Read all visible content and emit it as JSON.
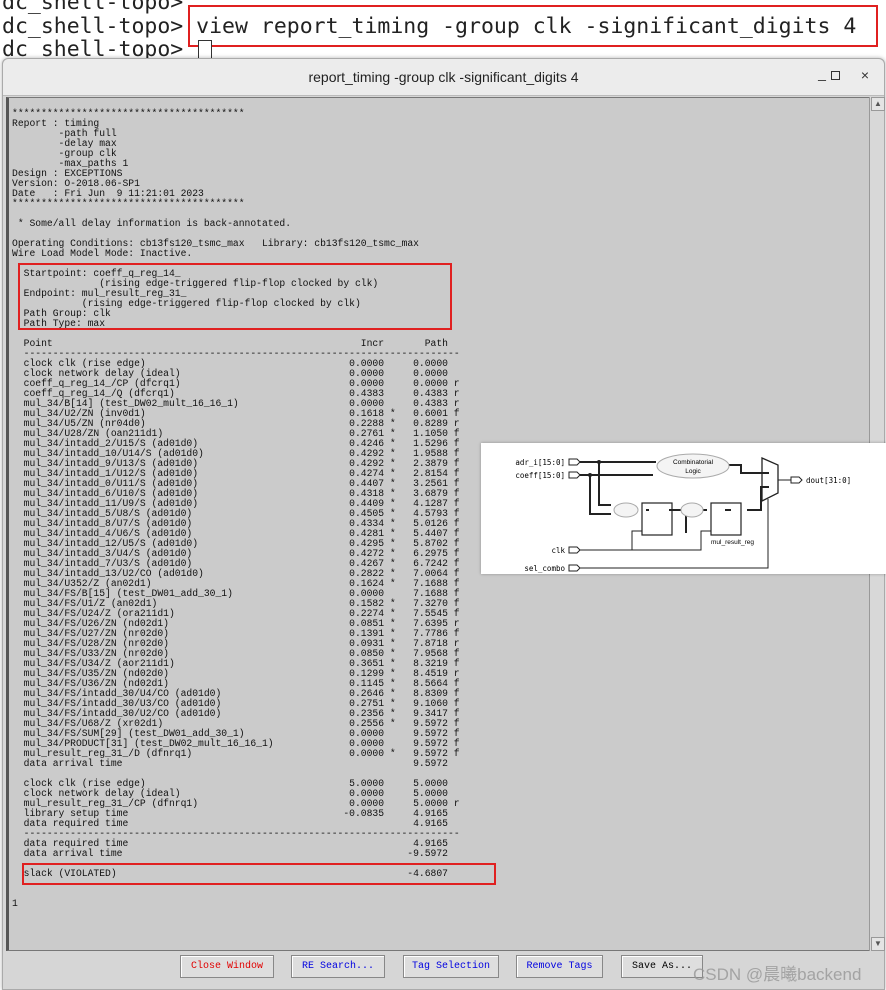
{
  "terminal": {
    "prompt": "dc_shell-topo>",
    "command": "view report_timing -group clk -significant_digits 4"
  },
  "window": {
    "title": "report_timing -group clk -significant_digits 4",
    "minimize": "_",
    "maximize": "□",
    "close": "×"
  },
  "report": {
    "header_lines": [
      "****************************************",
      "Report : timing",
      "        -path full",
      "        -delay max",
      "        -group clk",
      "        -max_paths 1",
      "Design : EXCEPTIONS",
      "Version: O-2018.06-SP1",
      "Date   : Fri Jun  9 11:21:01 2023",
      "****************************************",
      "",
      " * Some/all delay information is back-annotated.",
      "",
      "Operating Conditions: cb13fs120_tsmc_max   Library: cb13fs120_tsmc_max",
      "Wire Load Model Mode: Inactive.",
      "",
      "  Startpoint: coeff_q_reg_14_",
      "               (rising edge-triggered flip-flop clocked by clk)",
      "  Endpoint: mul_result_reg_31_",
      "            (rising edge-triggered flip-flop clocked by clk)",
      "  Path Group: clk",
      "  Path Type: max",
      ""
    ],
    "columns": {
      "point": "Point",
      "incr": "Incr",
      "path": "Path"
    },
    "arrival_rows": [
      {
        "point": "clock clk (rise edge)",
        "incr": "0.0000",
        "star": "",
        "path": "0.0000",
        "edge": ""
      },
      {
        "point": "clock network delay (ideal)",
        "incr": "0.0000",
        "star": "",
        "path": "0.0000",
        "edge": ""
      },
      {
        "point": "coeff_q_reg_14_/CP (dfcrq1)",
        "incr": "0.0000",
        "star": "",
        "path": "0.0000",
        "edge": "r"
      },
      {
        "point": "coeff_q_reg_14_/Q (dfcrq1)",
        "incr": "0.4383",
        "star": "",
        "path": "0.4383",
        "edge": "r"
      },
      {
        "point": "mul_34/B[14] (test_DW02_mult_16_16_1)",
        "incr": "0.0000",
        "star": "",
        "path": "0.4383",
        "edge": "r"
      },
      {
        "point": "mul_34/U2/ZN (inv0d1)",
        "incr": "0.1618",
        "star": "*",
        "path": "0.6001",
        "edge": "f"
      },
      {
        "point": "mul_34/U5/ZN (nr04d0)",
        "incr": "0.2288",
        "star": "*",
        "path": "0.8289",
        "edge": "r"
      },
      {
        "point": "mul_34/U28/ZN (oan211d1)",
        "incr": "0.2761",
        "star": "*",
        "path": "1.1050",
        "edge": "f"
      },
      {
        "point": "mul_34/intadd_2/U15/S (ad01d0)",
        "incr": "0.4246",
        "star": "*",
        "path": "1.5296",
        "edge": "f"
      },
      {
        "point": "mul_34/intadd_10/U14/S (ad01d0)",
        "incr": "0.4292",
        "star": "*",
        "path": "1.9588",
        "edge": "f"
      },
      {
        "point": "mul_34/intadd_9/U13/S (ad01d0)",
        "incr": "0.4292",
        "star": "*",
        "path": "2.3879",
        "edge": "f"
      },
      {
        "point": "mul_34/intadd_1/U12/S (ad01d0)",
        "incr": "0.4274",
        "star": "*",
        "path": "2.8154",
        "edge": "f"
      },
      {
        "point": "mul_34/intadd_0/U11/S (ad01d0)",
        "incr": "0.4407",
        "star": "*",
        "path": "3.2561",
        "edge": "f"
      },
      {
        "point": "mul_34/intadd_6/U10/S (ad01d0)",
        "incr": "0.4318",
        "star": "*",
        "path": "3.6879",
        "edge": "f"
      },
      {
        "point": "mul_34/intadd_11/U9/S (ad01d0)",
        "incr": "0.4409",
        "star": "*",
        "path": "4.1287",
        "edge": "f"
      },
      {
        "point": "mul_34/intadd_5/U8/S (ad01d0)",
        "incr": "0.4505",
        "star": "*",
        "path": "4.5793",
        "edge": "f"
      },
      {
        "point": "mul_34/intadd_8/U7/S (ad01d0)",
        "incr": "0.4334",
        "star": "*",
        "path": "5.0126",
        "edge": "f"
      },
      {
        "point": "mul_34/intadd_4/U6/S (ad01d0)",
        "incr": "0.4281",
        "star": "*",
        "path": "5.4407",
        "edge": "f"
      },
      {
        "point": "mul_34/intadd_12/U5/S (ad01d0)",
        "incr": "0.4295",
        "star": "*",
        "path": "5.8702",
        "edge": "f"
      },
      {
        "point": "mul_34/intadd_3/U4/S (ad01d0)",
        "incr": "0.4272",
        "star": "*",
        "path": "6.2975",
        "edge": "f"
      },
      {
        "point": "mul_34/intadd_7/U3/S (ad01d0)",
        "incr": "0.4267",
        "star": "*",
        "path": "6.7242",
        "edge": "f"
      },
      {
        "point": "mul_34/intadd_13/U2/CO (ad01d0)",
        "incr": "0.2822",
        "star": "*",
        "path": "7.0064",
        "edge": "f"
      },
      {
        "point": "mul_34/U352/Z (an02d1)",
        "incr": "0.1624",
        "star": "*",
        "path": "7.1688",
        "edge": "f"
      },
      {
        "point": "mul_34/FS/B[15] (test_DW01_add_30_1)",
        "incr": "0.0000",
        "star": "",
        "path": "7.1688",
        "edge": "f"
      },
      {
        "point": "mul_34/FS/U1/Z (an02d1)",
        "incr": "0.1582",
        "star": "*",
        "path": "7.3270",
        "edge": "f"
      },
      {
        "point": "mul_34/FS/U24/Z (ora211d1)",
        "incr": "0.2274",
        "star": "*",
        "path": "7.5545",
        "edge": "f"
      },
      {
        "point": "mul_34/FS/U26/ZN (nd02d1)",
        "incr": "0.0851",
        "star": "*",
        "path": "7.6395",
        "edge": "r"
      },
      {
        "point": "mul_34/FS/U27/ZN (nr02d0)",
        "incr": "0.1391",
        "star": "*",
        "path": "7.7786",
        "edge": "f"
      },
      {
        "point": "mul_34/FS/U28/ZN (nr02d0)",
        "incr": "0.0931",
        "star": "*",
        "path": "7.8718",
        "edge": "r"
      },
      {
        "point": "mul_34/FS/U33/ZN (nr02d0)",
        "incr": "0.0850",
        "star": "*",
        "path": "7.9568",
        "edge": "f"
      },
      {
        "point": "mul_34/FS/U34/Z (aor211d1)",
        "incr": "0.3651",
        "star": "*",
        "path": "8.3219",
        "edge": "f"
      },
      {
        "point": "mul_34/FS/U35/ZN (nd02d0)",
        "incr": "0.1299",
        "star": "*",
        "path": "8.4519",
        "edge": "r"
      },
      {
        "point": "mul_34/FS/U36/ZN (nd02d1)",
        "incr": "0.1145",
        "star": "*",
        "path": "8.5664",
        "edge": "f"
      },
      {
        "point": "mul_34/FS/intadd_30/U4/CO (ad01d0)",
        "incr": "0.2646",
        "star": "*",
        "path": "8.8309",
        "edge": "f"
      },
      {
        "point": "mul_34/FS/intadd_30/U3/CO (ad01d0)",
        "incr": "0.2751",
        "star": "*",
        "path": "9.1060",
        "edge": "f"
      },
      {
        "point": "mul_34/FS/intadd_30/U2/CO (ad01d0)",
        "incr": "0.2356",
        "star": "*",
        "path": "9.3417",
        "edge": "f"
      },
      {
        "point": "mul_34/FS/U68/Z (xr02d1)",
        "incr": "0.2556",
        "star": "*",
        "path": "9.5972",
        "edge": "f"
      },
      {
        "point": "mul_34/FS/SUM[29] (test_DW01_add_30_1)",
        "incr": "0.0000",
        "star": "",
        "path": "9.5972",
        "edge": "f"
      },
      {
        "point": "mul_34/PRODUCT[31] (test_DW02_mult_16_16_1)",
        "incr": "0.0000",
        "star": "",
        "path": "9.5972",
        "edge": "f"
      },
      {
        "point": "mul_result_reg_31_/D (dfnrq1)",
        "incr": "0.0000",
        "star": "*",
        "path": "9.5972",
        "edge": "f"
      },
      {
        "point": "data arrival time",
        "incr": "",
        "star": "",
        "path": "9.5972",
        "edge": ""
      }
    ],
    "required_rows": [
      {
        "point": "clock clk (rise edge)",
        "incr": "5.0000",
        "star": "",
        "path": "5.0000",
        "edge": ""
      },
      {
        "point": "clock network delay (ideal)",
        "incr": "0.0000",
        "star": "",
        "path": "5.0000",
        "edge": ""
      },
      {
        "point": "mul_result_reg_31_/CP (dfnrq1)",
        "incr": "0.0000",
        "star": "",
        "path": "5.0000",
        "edge": "r"
      },
      {
        "point": "library setup time",
        "incr": "-0.0835",
        "star": "",
        "path": "4.9165",
        "edge": ""
      },
      {
        "point": "data required time",
        "incr": "",
        "star": "",
        "path": "4.9165",
        "edge": ""
      }
    ],
    "summary_rows": [
      {
        "point": "data required time",
        "incr": "",
        "star": "",
        "path": "4.9165",
        "edge": ""
      },
      {
        "point": "data arrival time",
        "incr": "",
        "star": "",
        "path": "-9.5972",
        "edge": ""
      }
    ],
    "slack": {
      "point": "slack (VIOLATED)",
      "incr": "",
      "star": "",
      "path": "-4.6807",
      "edge": ""
    },
    "trailer": "1"
  },
  "diagram": {
    "inputs": [
      "adr_i[15:0]",
      "coeff[15:0]",
      "clk",
      "sel_combo"
    ],
    "output": "dout[31:0]",
    "cloud_label_1": "Combinatorial",
    "cloud_label_2": "Logic",
    "register_label": "mul_result_reg"
  },
  "buttons": [
    {
      "label": "Close Window",
      "color": "#e00000"
    },
    {
      "label": "RE Search...",
      "color": "#0000e0"
    },
    {
      "label": "Tag Selection",
      "color": "#0000e0"
    },
    {
      "label": "Remove Tags",
      "color": "#0000e0"
    },
    {
      "label": "Save As...",
      "color": "#000000"
    }
  ],
  "watermark": "CSDN @晨曦backend"
}
